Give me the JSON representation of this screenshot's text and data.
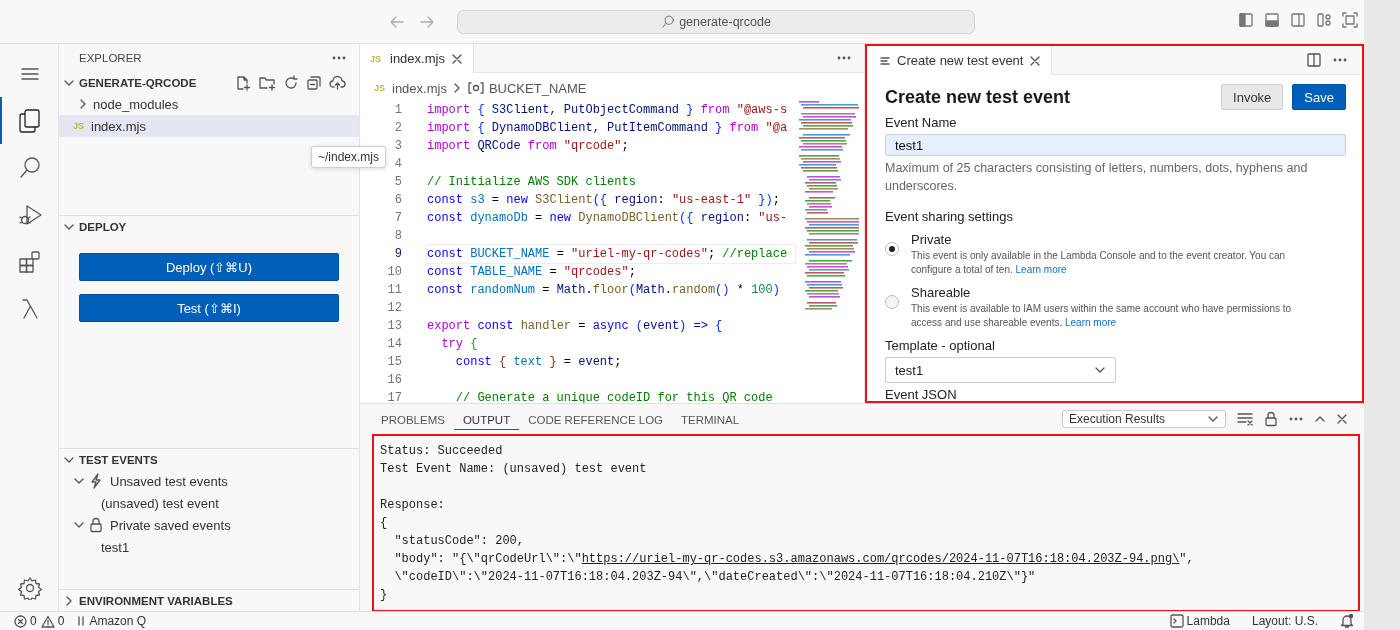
{
  "title_bar": {
    "search": "generate-qrcode"
  },
  "activity_bar": {
    "items": [
      {
        "kind": "menu",
        "selected": false
      },
      {
        "kind": "explorer",
        "selected": true
      },
      {
        "kind": "search",
        "selected": false
      },
      {
        "kind": "run",
        "selected": false
      },
      {
        "kind": "extensions",
        "selected": false
      },
      {
        "kind": "lambda",
        "selected": false
      }
    ]
  },
  "sidebar": {
    "title": "EXPLORER",
    "sections": [
      {
        "kind": "files",
        "title": "GENERATE-QRCODE",
        "expanded": true,
        "items": [
          {
            "label": "node_modules",
            "kind": "folder",
            "expanded": false,
            "selected": false
          },
          {
            "label": "index.mjs",
            "kind": "file",
            "badge": "JS",
            "selected": true
          }
        ],
        "tooltip": "~/index.mjs"
      },
      {
        "kind": "buttons",
        "title": "DEPLOY",
        "expanded": true,
        "buttons": [
          "Deploy (⇧⌘U)",
          "Test (⇧⌘I)"
        ]
      },
      {
        "kind": "tree",
        "title": "TEST EVENTS",
        "expanded": true,
        "items": [
          {
            "label": "Unsaved test events",
            "kind": "unsaved",
            "expanded": true,
            "children": [
              {
                "label": "(unsaved) test event"
              }
            ]
          },
          {
            "label": "Private saved events",
            "kind": "private",
            "expanded": true,
            "children": [
              {
                "label": "test1"
              }
            ]
          }
        ]
      },
      {
        "kind": "tree",
        "title": "ENVIRONMENT VARIABLES",
        "expanded": false
      }
    ]
  },
  "editor": {
    "tabs": [
      {
        "label": "index.mjs",
        "badge": "JS",
        "selected": true
      }
    ],
    "breadcrumb": {
      "badge": "JS",
      "file": "index.mjs",
      "symbol": "BUCKET_NAME"
    },
    "lines": [
      {
        "number": "1",
        "current": false,
        "tokens": [
          {
            "kind": "kw",
            "text": "import"
          },
          {
            "kind": "br",
            "text": " {"
          },
          {
            "kind": "id",
            "text": " S3Client, PutObjectCommand "
          },
          {
            "kind": "br",
            "text": "}"
          },
          {
            "kind": "kw",
            "text": " from"
          },
          {
            "kind": "str",
            "text": " \"@aws-s"
          }
        ]
      },
      {
        "number": "2",
        "current": false,
        "tokens": [
          {
            "kind": "kw",
            "text": "import"
          },
          {
            "kind": "br",
            "text": " {"
          },
          {
            "kind": "id",
            "text": " DynamoDBClient, PutItemCommand "
          },
          {
            "kind": "br",
            "text": "}"
          },
          {
            "kind": "kw",
            "text": " from"
          },
          {
            "kind": "str",
            "text": " \"@a"
          }
        ]
      },
      {
        "number": "3",
        "current": false,
        "tokens": [
          {
            "kind": "kw",
            "text": "import"
          },
          {
            "kind": "id",
            "text": " QRCode "
          },
          {
            "kind": "kw",
            "text": "from"
          },
          {
            "kind": "str",
            "text": " \"qrcode\""
          },
          {
            "kind": "p",
            "text": ";"
          }
        ]
      },
      {
        "number": "4",
        "current": false
      },
      {
        "number": "5",
        "current": false,
        "tokens": [
          {
            "kind": "cmt",
            "text": "// Initialize AWS SDK clients"
          }
        ]
      },
      {
        "number": "6",
        "current": false,
        "tokens": [
          {
            "kind": "decl",
            "text": "const"
          },
          {
            "kind": "var",
            "text": " s3"
          },
          {
            "kind": "p",
            "text": " = "
          },
          {
            "kind": "decl",
            "text": "new"
          },
          {
            "kind": "func",
            "text": " S3Client"
          },
          {
            "kind": "br",
            "text": "({"
          },
          {
            "kind": "id",
            "text": " region"
          },
          {
            "kind": "p",
            "text": ": "
          },
          {
            "kind": "str",
            "text": "\"us-east-1\""
          },
          {
            "kind": "br",
            "text": " })"
          },
          {
            "kind": "p",
            "text": ";"
          }
        ]
      },
      {
        "number": "7",
        "current": false,
        "tokens": [
          {
            "kind": "decl",
            "text": "const"
          },
          {
            "kind": "var",
            "text": " dynamoDb"
          },
          {
            "kind": "p",
            "text": " = "
          },
          {
            "kind": "decl",
            "text": "new"
          },
          {
            "kind": "func",
            "text": " DynamoDBClient"
          },
          {
            "kind": "br",
            "text": "({"
          },
          {
            "kind": "id",
            "text": " region"
          },
          {
            "kind": "p",
            "text": ": "
          },
          {
            "kind": "str",
            "text": "\"us-"
          }
        ]
      },
      {
        "number": "8",
        "current": false
      },
      {
        "number": "9",
        "current": true,
        "tokens": [
          {
            "kind": "decl",
            "text": "const"
          },
          {
            "kind": "var",
            "text": " BUCKET_NAME"
          },
          {
            "kind": "p",
            "text": " = "
          },
          {
            "kind": "str",
            "text": "\"uriel-my-qr-codes\""
          },
          {
            "kind": "p",
            "text": ";"
          },
          {
            "kind": "cmt",
            "text": " //replace"
          }
        ]
      },
      {
        "number": "10",
        "current": false,
        "tokens": [
          {
            "kind": "decl",
            "text": "const"
          },
          {
            "kind": "var",
            "text": " TABLE_NAME"
          },
          {
            "kind": "p",
            "text": " = "
          },
          {
            "kind": "str",
            "text": "\"qrcodes\""
          },
          {
            "kind": "p",
            "text": ";"
          }
        ]
      },
      {
        "number": "11",
        "current": false,
        "tokens": [
          {
            "kind": "decl",
            "text": "const"
          },
          {
            "kind": "var",
            "text": " randomNum"
          },
          {
            "kind": "p",
            "text": " = "
          },
          {
            "kind": "id",
            "text": "Math"
          },
          {
            "kind": "p",
            "text": "."
          },
          {
            "kind": "func",
            "text": "floor"
          },
          {
            "kind": "br",
            "text": "("
          },
          {
            "kind": "id",
            "text": "Math"
          },
          {
            "kind": "p",
            "text": "."
          },
          {
            "kind": "func",
            "text": "random"
          },
          {
            "kind": "br",
            "text": "()"
          },
          {
            "kind": "p",
            "text": " * "
          },
          {
            "kind": "num",
            "text": "100"
          },
          {
            "kind": "br",
            "text": ")"
          }
        ]
      },
      {
        "number": "12",
        "current": false
      },
      {
        "number": "13",
        "current": false,
        "tokens": [
          {
            "kind": "kw",
            "text": "export"
          },
          {
            "kind": "decl",
            "text": " const"
          },
          {
            "kind": "func",
            "text": " handler"
          },
          {
            "kind": "p",
            "text": " = "
          },
          {
            "kind": "decl",
            "text": "async"
          },
          {
            "kind": "br",
            "text": " ("
          },
          {
            "kind": "id",
            "text": "event"
          },
          {
            "kind": "br",
            "text": ")"
          },
          {
            "kind": "decl",
            "text": " =>"
          },
          {
            "kind": "br",
            "text": " {"
          }
        ]
      },
      {
        "number": "14",
        "current": false,
        "tokens": [
          {
            "kind": "kw",
            "text": "  try"
          },
          {
            "kind": "br2",
            "text": " {"
          }
        ]
      },
      {
        "number": "15",
        "current": false,
        "tokens": [
          {
            "kind": "decl",
            "text": "    const"
          },
          {
            "kind": "br3",
            "text": " {"
          },
          {
            "kind": "var",
            "text": " text "
          },
          {
            "kind": "br3",
            "text": "}"
          },
          {
            "kind": "p",
            "text": " = "
          },
          {
            "kind": "id",
            "text": "event"
          },
          {
            "kind": "p",
            "text": ";"
          }
        ]
      },
      {
        "number": "16",
        "current": false
      },
      {
        "number": "17",
        "current": false,
        "tokens": [
          {
            "kind": "cmt",
            "text": "    // Generate a unique codeID for this QR code"
          }
        ]
      }
    ]
  },
  "test_event_panel": {
    "highlighted": true,
    "tab": {
      "label": "Create new test event",
      "selected": true
    },
    "heading": "Create new test event",
    "buttons": [
      {
        "label": "Invoke",
        "kind": "secondary"
      },
      {
        "label": "Save",
        "kind": "primary"
      }
    ],
    "event_name": {
      "label": "Event Name",
      "value": "test1",
      "hint": "Maximum of 25 characters consisting of letters, numbers, dots, hyphens and underscores."
    },
    "sharing": {
      "label": "Event sharing settings",
      "options": [
        {
          "label": "Private",
          "selected": true,
          "description": "This event is only available in the Lambda Console and to the event creator. You can configure a total of ten.",
          "link": "Learn more"
        },
        {
          "label": "Shareable",
          "selected": false,
          "description": "This event is available to IAM users within the same account who have permissions to access and use shareable events.",
          "link": "Learn more"
        }
      ]
    },
    "template": {
      "label": "Template - optional",
      "value": "test1"
    },
    "json_label": "Event JSON"
  },
  "bottom_panel": {
    "tabs": [
      {
        "label": "PROBLEMS",
        "selected": false
      },
      {
        "label": "OUTPUT",
        "selected": true
      },
      {
        "label": "CODE REFERENCE LOG",
        "selected": false
      },
      {
        "label": "TERMINAL",
        "selected": false
      }
    ],
    "output_select": "Execution Results",
    "highlighted": true,
    "blocks": [
      {
        "lines": [
          {
            "segments": [
              {
                "kind": "text",
                "text": "Status: Succeeded"
              }
            ]
          },
          {
            "segments": [
              {
                "kind": "text",
                "text": "Test Event Name: (unsaved) test event"
              }
            ]
          }
        ]
      },
      {
        "lines": [
          {
            "segments": [
              {
                "kind": "text",
                "text": "Response:"
              }
            ]
          },
          {
            "segments": [
              {
                "kind": "text",
                "text": "{"
              }
            ]
          },
          {
            "segments": [
              {
                "kind": "text",
                "text": "  \"statusCode\": 200,"
              }
            ]
          },
          {
            "segments": [
              {
                "kind": "text",
                "text": "  \"body\": \"{\\\"qrCodeUrl\\\":\\\""
              },
              {
                "kind": "link",
                "text": "https://uriel-my-qr-codes.s3.amazonaws.com/qrcodes/2024-11-07T16:18:04.203Z-94.png\\"
              },
              {
                "kind": "text",
                "text": "\","
              }
            ]
          },
          {
            "segments": [
              {
                "kind": "text",
                "text": "  \\\"codeID\\\":\\\"2024-11-07T16:18:04.203Z-94\\\",\\\"dateCreated\\\":\\\"2024-11-07T16:18:04.210Z\\\"}\""
              }
            ]
          },
          {
            "segments": [
              {
                "kind": "text",
                "text": "}"
              }
            ]
          }
        ]
      }
    ]
  },
  "status_bar": {
    "left": [
      {
        "kind": "errors",
        "text": "0"
      },
      {
        "kind": "warnings",
        "text": "0"
      },
      {
        "kind": "amazon-q",
        "text": "Amazon Q"
      }
    ],
    "right": [
      {
        "kind": "terminal",
        "text": "Lambda"
      },
      {
        "kind": "plain",
        "text": "Layout: U.S."
      },
      {
        "kind": "bell"
      }
    ]
  }
}
